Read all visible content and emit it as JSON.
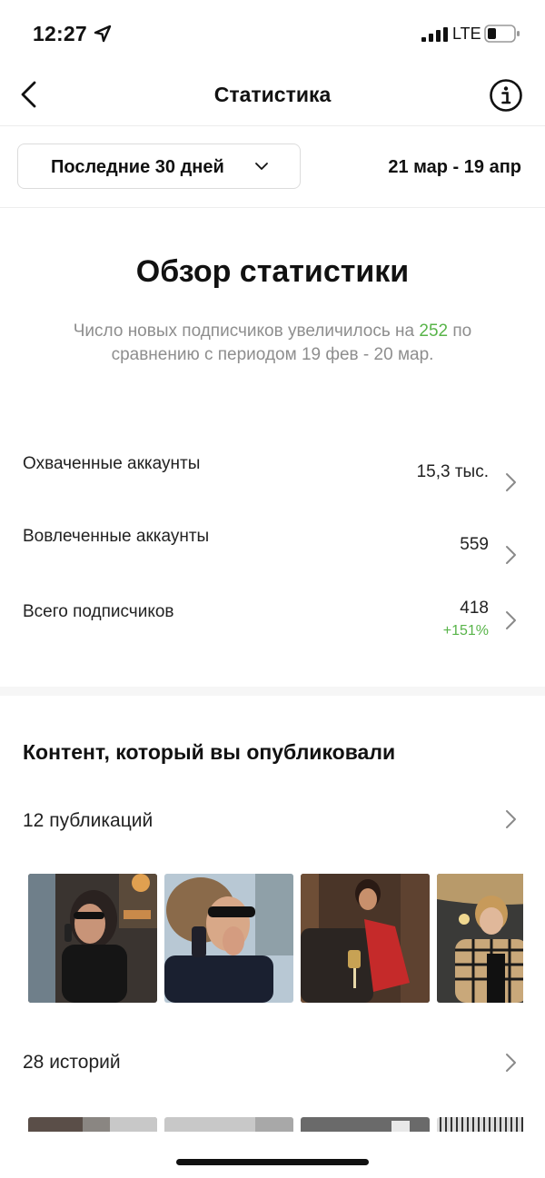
{
  "status_bar": {
    "time": "12:27",
    "network": "LTE",
    "icons": [
      "location-arrow-icon",
      "signal-bars-icon",
      "battery-icon"
    ]
  },
  "nav": {
    "title": "Статистика",
    "back_icon": "chevron-left-icon",
    "info_icon": "info-circle-icon"
  },
  "filter": {
    "range_label": "Последние 30 дней",
    "date_range": "21 мар - 19 апр"
  },
  "overview": {
    "title": "Обзор статистики",
    "summary_prefix": "Число новых подписчиков увеличилось на",
    "summary_number": "252",
    "summary_suffix": "по сравнению с периодом 19 фев - 20 мар.",
    "accent_color": "#58b449"
  },
  "stats": [
    {
      "label": "Охваченные аккаунты",
      "value": "15,3 тыс."
    },
    {
      "label": "Вовлеченные аккаунты",
      "value": "559"
    },
    {
      "label": "Всего подписчиков",
      "value": "418",
      "change": "+151%"
    }
  ],
  "content": {
    "title": "Контент, который вы опубликовали",
    "posts_label": "12 публикаций",
    "stories_label": "28 историй"
  }
}
